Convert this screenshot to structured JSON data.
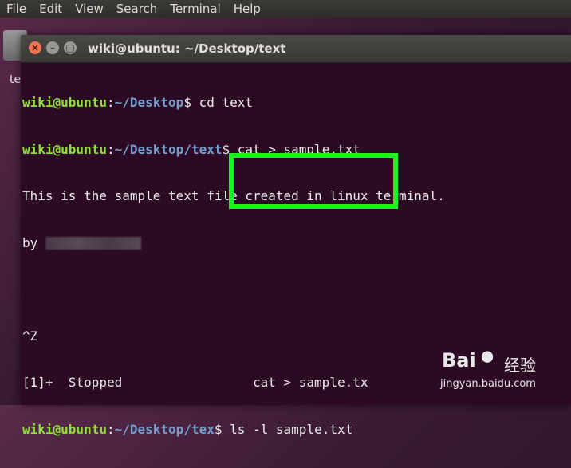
{
  "menubar": {
    "items": [
      "File",
      "Edit",
      "View",
      "Search",
      "Terminal",
      "Help"
    ]
  },
  "desktop": {
    "folder_label": "te"
  },
  "window": {
    "title": "wiki@ubuntu: ~/Desktop/text",
    "close_glyph": "×",
    "min_glyph": "–",
    "max_glyph": "□"
  },
  "terminal": {
    "line1": {
      "user": "wiki@ubuntu",
      "sep": ":",
      "path": "~/Desktop",
      "cmd": "$ cd text"
    },
    "line2": {
      "user": "wiki@ubuntu",
      "sep": ":",
      "path": "~/Desktop/text",
      "cmd": "$ cat > sample.txt"
    },
    "line3": "This is the sample text file created in linux terminal.",
    "line4": "by ",
    "line5": "",
    "line6": "^Z",
    "line7": "[1]+  Stopped                 cat > sample.tx",
    "line8": {
      "user": "wiki@ubuntu",
      "sep": ":",
      "path": "~/Desktop/tex",
      "cmd": "$ ls -l sample.txt"
    }
  },
  "highlight_color": "#22ee22",
  "watermark": {
    "logo": "Bai",
    "cn": "经验",
    "url": "jingyan.baidu.com"
  }
}
